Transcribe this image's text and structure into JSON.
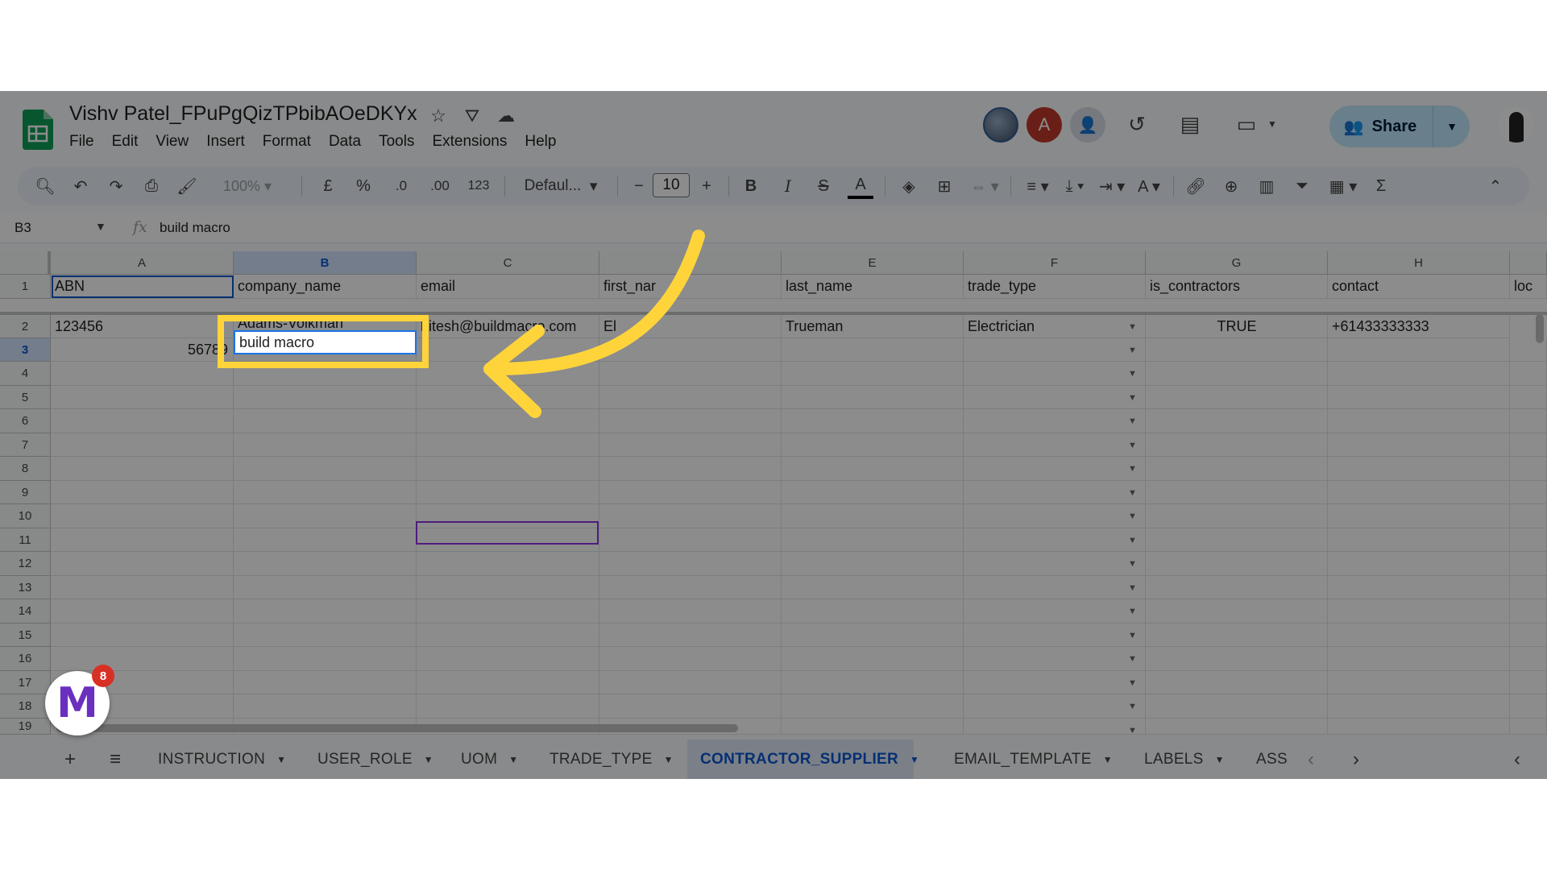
{
  "title_bar": {
    "doc_title": "Vishv Patel_FPuPgQizTPbibAOeDKYx",
    "avatar_initial": "A",
    "share_label": "Share"
  },
  "menu": [
    "File",
    "Edit",
    "View",
    "Insert",
    "Format",
    "Data",
    "Tools",
    "Extensions",
    "Help"
  ],
  "toolbar": {
    "zoom": "100%",
    "currency": "£",
    "percent": "%",
    "dec_decrease": ".0",
    "dec_increase": ".00",
    "number_format": "123",
    "font": "Defaul...",
    "font_size": "10"
  },
  "formula_bar": {
    "cell_ref": "B3",
    "fx": "fx",
    "value": "build macro"
  },
  "columns": [
    "A",
    "B",
    "C",
    "D",
    "E",
    "F",
    "G",
    "H"
  ],
  "rows": [
    "1",
    "2",
    "3",
    "4",
    "5",
    "6",
    "7",
    "8",
    "9",
    "10",
    "11",
    "12",
    "13",
    "14",
    "15",
    "16",
    "17",
    "18",
    "19"
  ],
  "header_row": [
    "ABN",
    "company_name",
    "email",
    "first_nar",
    "last_name",
    "trade_type",
    "is_contractors",
    "contact",
    "loc"
  ],
  "row2": {
    "abn": "123456",
    "company_name": "Adams-Volkman",
    "email": "hitesh@buildmacro.com",
    "first_name": "El",
    "last_name": "Trueman",
    "trade_type": "Electrician",
    "is_contractors": "TRUE",
    "contact": "+61433333333"
  },
  "row3": {
    "abn": "56789",
    "company_name_editing": "build macro"
  },
  "sheet_tabs": [
    "INSTRUCTION",
    "USER_ROLE",
    "UOM",
    "TRADE_TYPE",
    "CONTRACTOR_SUPPLIER",
    "EMAIL_TEMPLATE",
    "LABELS",
    "ASS"
  ],
  "active_tab": "CONTRACTOR_SUPPLIER",
  "badge": {
    "count": "8",
    "letter": "M"
  },
  "colors": {
    "highlight": "#ffd43b",
    "accent": "#0b57d0",
    "share_bg": "#c2e7ff"
  }
}
